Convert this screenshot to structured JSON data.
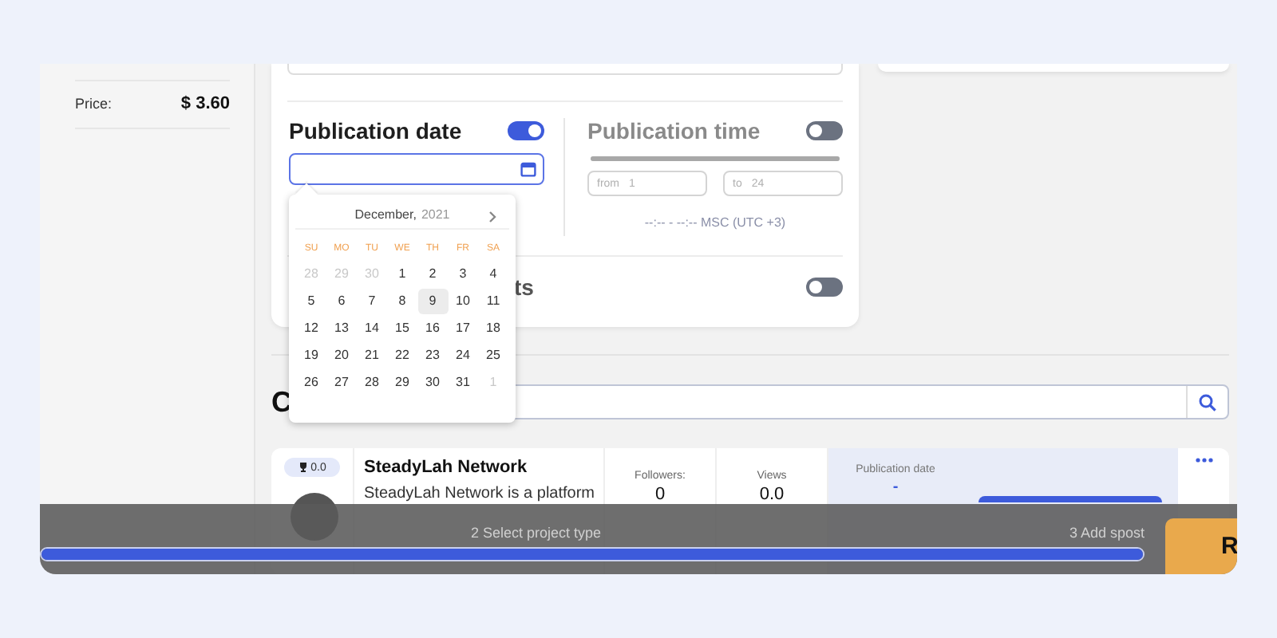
{
  "sidebar": {
    "price_label": "Price:",
    "price_value": "$ 3.60"
  },
  "publication_date": {
    "title": "Publication date",
    "on": true
  },
  "publication_time": {
    "title": "Publication time",
    "on": false,
    "level": 1,
    "from_label": "from",
    "from_value": "1",
    "to_label": "to",
    "to_value": "24",
    "range": "--:-- - --:-- MSC (UTC +3)"
  },
  "third_option": {
    "title": "ts",
    "on": false
  },
  "calendar": {
    "month": "December,",
    "year": "2021",
    "weekdays": [
      "SU",
      "MO",
      "TU",
      "WE",
      "TH",
      "FR",
      "SA"
    ],
    "weeks": [
      [
        {
          "day": "28",
          "muted": true,
          "selected": false
        },
        {
          "day": "29",
          "muted": true,
          "selected": false
        },
        {
          "day": "30",
          "muted": true,
          "selected": false
        },
        {
          "day": "1",
          "muted": false,
          "selected": false
        },
        {
          "day": "2",
          "muted": false,
          "selected": false
        },
        {
          "day": "3",
          "muted": false,
          "selected": false
        },
        {
          "day": "4",
          "muted": false,
          "selected": false
        }
      ],
      [
        {
          "day": "5",
          "muted": false,
          "selected": false
        },
        {
          "day": "6",
          "muted": false,
          "selected": false
        },
        {
          "day": "7",
          "muted": false,
          "selected": false
        },
        {
          "day": "8",
          "muted": false,
          "selected": false
        },
        {
          "day": "9",
          "muted": false,
          "selected": true
        },
        {
          "day": "10",
          "muted": false,
          "selected": false
        },
        {
          "day": "11",
          "muted": false,
          "selected": false
        }
      ],
      [
        {
          "day": "12",
          "muted": false,
          "selected": false
        },
        {
          "day": "13",
          "muted": false,
          "selected": false
        },
        {
          "day": "14",
          "muted": false,
          "selected": false
        },
        {
          "day": "15",
          "muted": false,
          "selected": false
        },
        {
          "day": "16",
          "muted": false,
          "selected": false
        },
        {
          "day": "17",
          "muted": false,
          "selected": false
        },
        {
          "day": "18",
          "muted": false,
          "selected": false
        }
      ],
      [
        {
          "day": "19",
          "muted": false,
          "selected": false
        },
        {
          "day": "20",
          "muted": false,
          "selected": false
        },
        {
          "day": "21",
          "muted": false,
          "selected": false
        },
        {
          "day": "22",
          "muted": false,
          "selected": false
        },
        {
          "day": "23",
          "muted": false,
          "selected": false
        },
        {
          "day": "24",
          "muted": false,
          "selected": false
        },
        {
          "day": "25",
          "muted": false,
          "selected": false
        }
      ],
      [
        {
          "day": "26",
          "muted": false,
          "selected": false
        },
        {
          "day": "27",
          "muted": false,
          "selected": false
        },
        {
          "day": "28",
          "muted": false,
          "selected": false
        },
        {
          "day": "29",
          "muted": false,
          "selected": false
        },
        {
          "day": "30",
          "muted": false,
          "selected": false
        },
        {
          "day": "31",
          "muted": false,
          "selected": false
        },
        {
          "day": "1",
          "muted": true,
          "selected": false
        }
      ]
    ]
  },
  "channels_heading": "C",
  "channel": {
    "rating": "0.0",
    "name": "SteadyLah Network",
    "description": "SteadyLah Network is a platform",
    "stats": [
      {
        "label": "Followers:",
        "value": "0"
      },
      {
        "label": "Views",
        "value": "0.0"
      }
    ],
    "date_label": "Publication date",
    "date_value": "-"
  },
  "progress": {
    "steps": [
      "2 Select project type",
      "3 Add spost"
    ],
    "level": 1
  },
  "next_button": "R"
}
